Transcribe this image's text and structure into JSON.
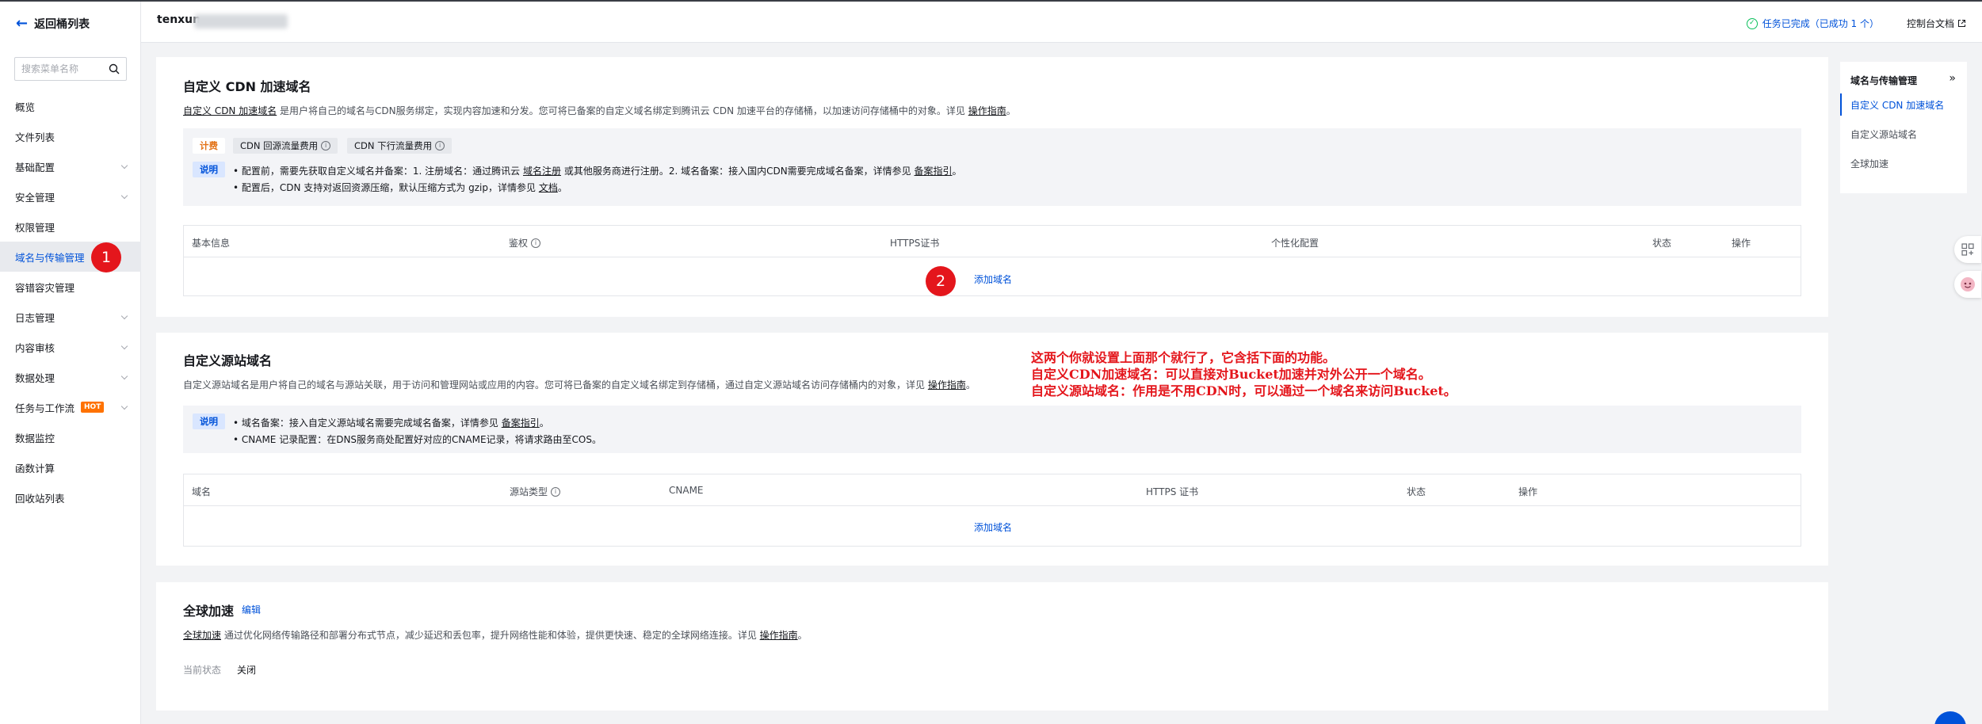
{
  "sidebar": {
    "back_label": "返回桶列表",
    "search_placeholder": "搜索菜单名称",
    "items": [
      {
        "label": "概览",
        "chevron": false
      },
      {
        "label": "文件列表",
        "chevron": false
      },
      {
        "label": "基础配置",
        "chevron": true
      },
      {
        "label": "安全管理",
        "chevron": true
      },
      {
        "label": "权限管理",
        "chevron": false
      },
      {
        "label": "域名与传输管理",
        "chevron": false,
        "active": true
      },
      {
        "label": "容错容灾管理",
        "chevron": false
      },
      {
        "label": "日志管理",
        "chevron": true
      },
      {
        "label": "内容审核",
        "chevron": true
      },
      {
        "label": "数据处理",
        "chevron": true
      },
      {
        "label": "任务与工作流",
        "chevron": true,
        "badge": "HOT"
      },
      {
        "label": "数据监控",
        "chevron": false
      },
      {
        "label": "函数计算",
        "chevron": false
      },
      {
        "label": "回收站列表",
        "chevron": false
      }
    ]
  },
  "header": {
    "bucket_name": "tenxun",
    "task_status": "任务已完成（已成功 1 个）",
    "doc_link": "控制台文档"
  },
  "annotations": {
    "marker_1": "1",
    "marker_2": "2",
    "note_lines": [
      "这两个你就设置上面那个就行了，它含括下面的功能。",
      "自定义CDN加速域名：可以直接对Bucket加速并对外公开一个域名。",
      "自定义源站域名：作用是不用CDN时，可以通过一个域名来访问Bucket。"
    ]
  },
  "cdn": {
    "title": "自定义 CDN 加速域名",
    "desc_link": "自定义 CDN 加速域名",
    "desc_text": " 是用户将自己的域名与CDN服务绑定，实现内容加速和分发。您可将已备案的自定义域名绑定到腾讯云 CDN 加速平台的存储桶，以加速访问存储桶中的对象。详见 ",
    "desc_guide": "操作指南",
    "desc_end": "。",
    "billing_tag": "计费",
    "billing_items": [
      "CDN 回源流量费用",
      "CDN 下行流量费用"
    ],
    "note_tag": "说明",
    "note_line1_a": "• 配置前，需要先获取自定义域名并备案：1. 注册域名：通过腾讯云 ",
    "note_line1_link1": "域名注册",
    "note_line1_b": " 或其他服务商进行注册。2. 域名备案：接入国内CDN需要完成域名备案，详情参见 ",
    "note_line1_link2": "备案指引",
    "note_line1_c": "。",
    "note_line2_a": "• 配置后，CDN 支持对返回资源压缩，默认压缩方式为 gzip，详情参见 ",
    "note_line2_link": "文档",
    "note_line2_b": "。",
    "columns": [
      "基本信息",
      "鉴权",
      "HTTPS证书",
      "个性化配置",
      "状态",
      "操作"
    ],
    "add_label": "添加域名"
  },
  "origin": {
    "title": "自定义源站域名",
    "desc_text": "自定义源站域名是用户将自己的域名与源站关联，用于访问和管理网站或应用的内容。您可将已备案的自定义域名绑定到存储桶，通过自定义源站域名访问存储桶内的对象，详见 ",
    "desc_guide": "操作指南",
    "desc_end": "。",
    "note_tag": "说明",
    "note_line1_a": "• 域名备案：接入自定义源站域名需要完成域名备案，详情参见 ",
    "note_line1_link": "备案指引",
    "note_line1_b": "。",
    "note_line2": "• CNAME 记录配置：在DNS服务商处配置好对应的CNAME记录，将请求路由至COS。",
    "columns": [
      "域名",
      "源站类型",
      "CNAME",
      "HTTPS 证书",
      "状态",
      "操作"
    ],
    "add_label": "添加域名"
  },
  "global": {
    "title": "全球加速",
    "edit_label": "编辑",
    "desc_link": "全球加速",
    "desc_text": " 通过优化网络传输路径和部署分布式节点，减少延迟和丢包率，提升网络性能和体验，提供更快速、稳定的全球网络连接。详见 ",
    "desc_guide": "操作指南",
    "desc_end": "。",
    "status_label": "当前状态",
    "status_value": "关闭"
  },
  "right_panel": {
    "title": "域名与传输管理",
    "items": [
      "自定义 CDN 加速域名",
      "自定义源站域名",
      "全球加速"
    ]
  },
  "colors": {
    "accent": "#0052d9",
    "annotation_red": "#e4161c",
    "billing_orange": "#e37318",
    "success_green": "#0abf5b"
  }
}
